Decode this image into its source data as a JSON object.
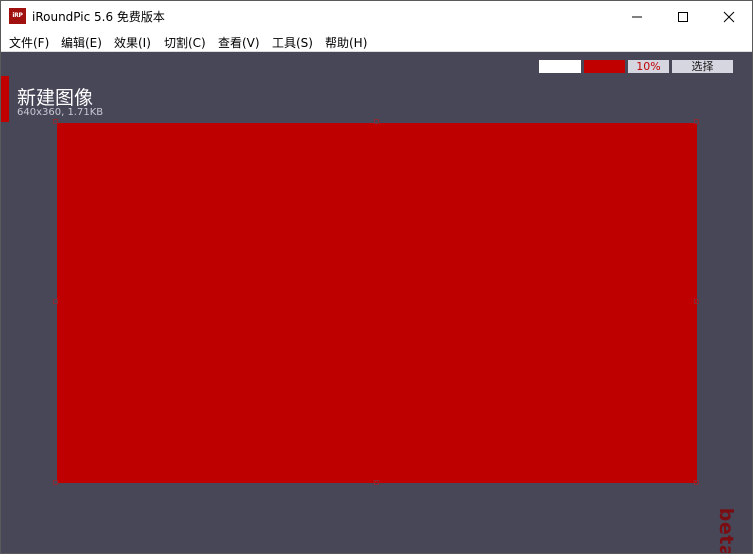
{
  "window": {
    "icon_text": "iRP",
    "title": "iRoundPic 5.6 免费版本",
    "controls": {
      "minimize": "minimize-icon",
      "maximize": "maximize-icon",
      "close": "close-icon"
    }
  },
  "menu": {
    "items": [
      {
        "label": "文件(F)"
      },
      {
        "label": "编辑(E)"
      },
      {
        "label": "效果(I)"
      },
      {
        "label": "切割(C)"
      },
      {
        "label": "查看(V)"
      },
      {
        "label": "工具(S)"
      },
      {
        "label": "帮助(H)"
      }
    ]
  },
  "toolbar": {
    "background_color": "#ffffff",
    "foreground_color": "#c00000",
    "radius_label": "10%",
    "select_label": "选择"
  },
  "image": {
    "title": "新建图像",
    "meta": "640x360, 1.71KB",
    "fill_color": "#be0000"
  },
  "watermark": {
    "text": "beta"
  },
  "colors": {
    "workspace": "#474758",
    "accent": "#c00000"
  }
}
